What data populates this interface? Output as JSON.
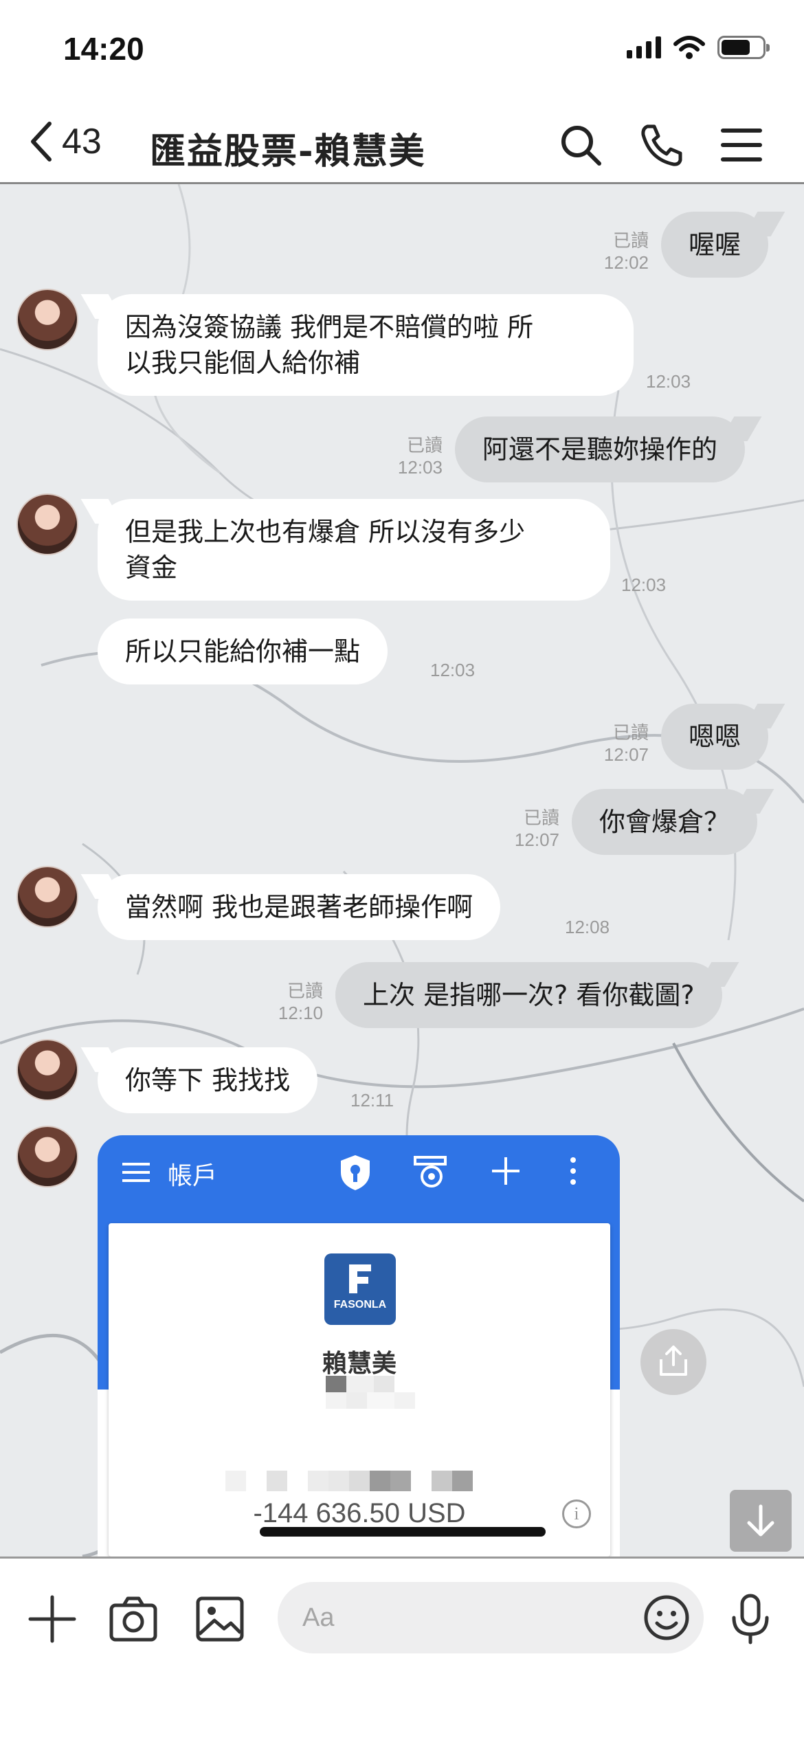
{
  "status_bar": {
    "time": "14:20"
  },
  "header": {
    "unread_count": "43",
    "title": "匯益股票-賴慧美"
  },
  "messages": {
    "m1": {
      "text": "喔喔",
      "read": "已讀",
      "time": "12:02"
    },
    "m2": {
      "line1": "因為沒簽協議  我們是不賠償的啦   所",
      "line2": "以我只能個人給你補",
      "time": "12:03"
    },
    "m3": {
      "text": "阿還不是聽妳操作的",
      "read": "已讀",
      "time": "12:03"
    },
    "m4": {
      "line1": "但是我上次也有爆倉  所以沒有多少",
      "line2": "資金",
      "time": "12:03"
    },
    "m5": {
      "text": "所以只能給你補一點",
      "time": "12:03"
    },
    "m6": {
      "text": "嗯嗯",
      "read": "已讀",
      "time": "12:07"
    },
    "m7": {
      "text": "你會爆倉？",
      "read": "已讀",
      "time": "12:07"
    },
    "m8": {
      "text": "當然啊  我也是跟著老師操作啊",
      "time": "12:08"
    },
    "m9": {
      "text": "上次  是指哪一次?  看你截圖?",
      "read": "已讀",
      "time": "12:10"
    },
    "m10": {
      "text": "你等下 我找找",
      "time": "12:11"
    }
  },
  "shared_card": {
    "menu_title": "帳戶",
    "logo_text": "FASONLA",
    "holder_name": "賴慧美",
    "balance": "-144 636.50 USD",
    "info_symbol": "i",
    "accent_color": "#2f74e6"
  },
  "input": {
    "placeholder": "Aa"
  },
  "icons": [
    "back-chevron",
    "search",
    "phone",
    "menu",
    "shield-key",
    "settings-gear",
    "plus",
    "more-vertical",
    "share",
    "arrow-down",
    "camera",
    "image",
    "emoji",
    "microphone"
  ]
}
